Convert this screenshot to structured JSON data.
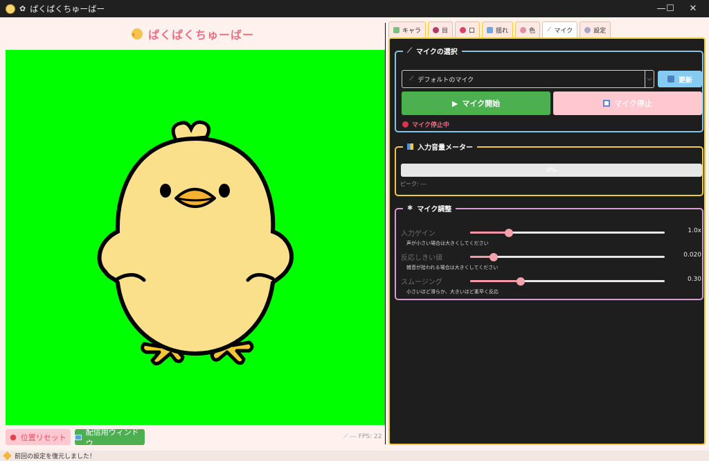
{
  "window": {
    "title": "ぱくぱくちゅーばー",
    "minimize": "—",
    "maximize": "☐",
    "close": "✕"
  },
  "left": {
    "header_title": "ぱくぱくちゅーばー",
    "reset_button": "位置リセット",
    "broadcast_button": "配信用ウィンドウ",
    "fps_text": "---    FPS: 22"
  },
  "tabs": [
    {
      "label": "キャラ",
      "color": "#7fbf7f"
    },
    {
      "label": "目",
      "color": "#b03a6a"
    },
    {
      "label": "口",
      "color": "#d9436a"
    },
    {
      "label": "揺れ",
      "color": "#6aa8e8"
    },
    {
      "label": "色",
      "color": "#e48fa3"
    },
    {
      "label": "マイク",
      "color": "#888888"
    },
    {
      "label": "設定",
      "color": "#a7a7c8"
    }
  ],
  "active_tab": "マイク",
  "mic_select": {
    "group_title": "マイクの選択",
    "device": "デフォルトのマイク",
    "refresh_button": "更新",
    "start_button": "マイク開始",
    "stop_button": "マイク停止",
    "status": "マイク停止中"
  },
  "meter": {
    "group_title": "入力音量メーター",
    "level_percent": 0,
    "level_text": "0%",
    "peak_text": "ピーク: ---"
  },
  "adjust": {
    "group_title": "マイク調整",
    "sliders": [
      {
        "label": "入力ゲイン",
        "value_text": "1.0x",
        "fraction": 0.2,
        "hint": "声が小さい場合は大きくしてください"
      },
      {
        "label": "反応しきい値",
        "value_text": "0.020",
        "fraction": 0.12,
        "hint": "雑音が拾われる場合は大きくしてください"
      },
      {
        "label": "スムージング",
        "value_text": "0.30",
        "fraction": 0.26,
        "hint": "小さいほど滑らか、大きいほど素早く反応"
      }
    ]
  },
  "statusbar": {
    "message": "前回の設定を復元しました！"
  },
  "colors": {
    "green_screen": "#00ff00",
    "accent_pink": "#ef6f84",
    "accent_green": "#4caf50",
    "tab_border": "#f5c845"
  }
}
